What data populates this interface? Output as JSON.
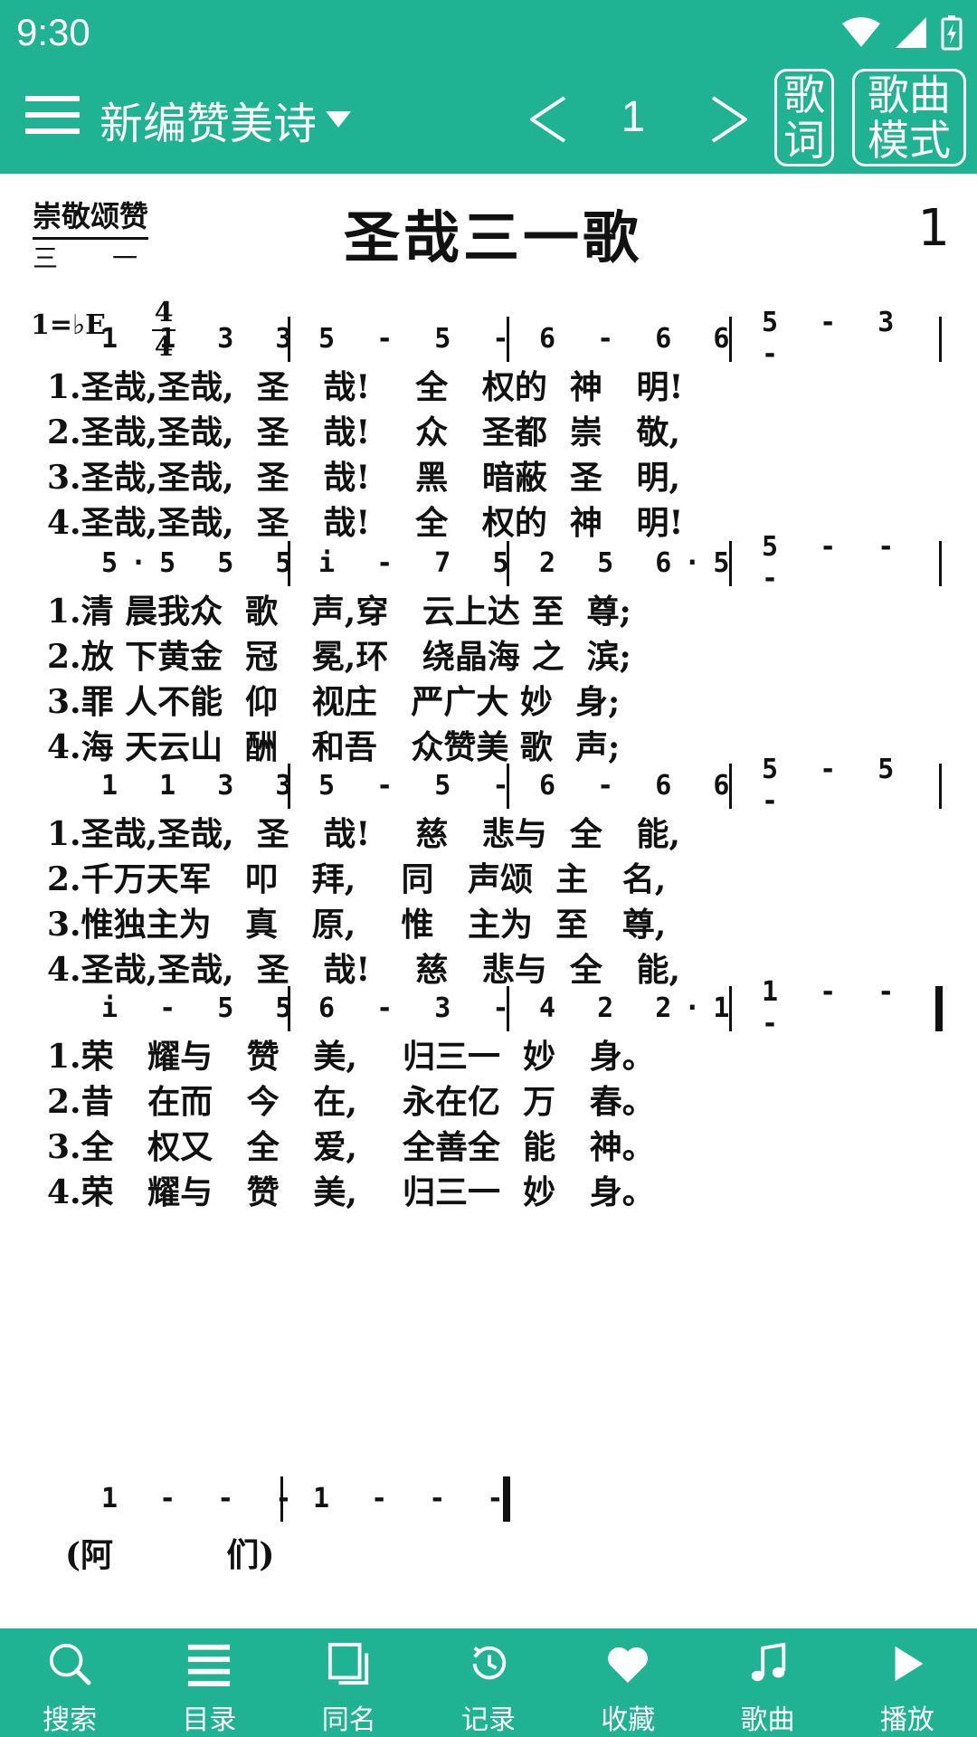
{
  "status": {
    "time": "9:30",
    "icons": [
      "wifi-icon",
      "signal-icon",
      "battery-charging-icon"
    ]
  },
  "appbar": {
    "book_title": "新编赞美诗",
    "page_number": "1",
    "lyrics_button": "歌词",
    "song_mode_button": "歌曲模式"
  },
  "score": {
    "category": "崇敬颂赞",
    "category_sub": "三一",
    "title": "圣哉三一歌",
    "number": "1",
    "key": "1=♭E",
    "time_top": "4",
    "time_bottom": "4",
    "systems": [
      {
        "measures": [
          "1 1 3 3",
          "5 - 5 -",
          "6 - 6 6",
          "5 - 3 -"
        ],
        "lyrics": [
          "1.圣哉,圣哉,  圣   哉!    全   权的  神   明!",
          "2.圣哉,圣哉,  圣   哉!    众   圣都  崇   敬,",
          "3.圣哉,圣哉,  圣   哉!    黑   暗蔽  圣   明,",
          "4.圣哉,圣哉,  圣   哉!    全   权的  神   明!"
        ]
      },
      {
        "measures": [
          "5·5 5 5",
          "i - 7 5",
          "2 5 6·5",
          "5 - - -"
        ],
        "lyrics": [
          "1.清 晨我众  歌   声,穿   云上达 至  尊;",
          "2.放 下黄金  冠   冕,环   绕晶海 之  滨;",
          "3.罪 人不能  仰   视庄   严广大 妙  身;",
          "4.海 天云山  酬   和吾   众赞美 歌  声;"
        ]
      },
      {
        "measures": [
          "1 1 3 3",
          "5 - 5 -",
          "6 - 6 6",
          "5 - 5 -"
        ],
        "lyrics": [
          "1.圣哉,圣哉,  圣   哉!    慈   悲与  全   能,",
          "2.千万天军   叩   拜,    同   声颂  主   名,",
          "3.惟独主为   真   原,    惟   主为  至   尊,",
          "4.圣哉,圣哉,  圣   哉!    慈   悲与  全   能,"
        ]
      },
      {
        "measures": [
          "i - 5 5",
          "6 - 3 -",
          "4 2 2·1",
          "1 - - -"
        ],
        "lyrics": [
          "1.荣   耀与   赞   美,    归三一  妙   身。",
          "2.昔   在而   今   在,    永在亿  万   春。",
          "3.全   权又   全   爱,    全善全  能   神。",
          "4.荣   耀与   赞   美,    归三一  妙   身。"
        ]
      },
      {
        "measures": [
          "1 - - -",
          "1 - - -"
        ],
        "lyrics": []
      }
    ],
    "amen": "(阿          们)"
  },
  "bottom_nav": [
    {
      "label": "搜索",
      "icon": "search-icon"
    },
    {
      "label": "目录",
      "icon": "list-icon"
    },
    {
      "label": "同名",
      "icon": "copy-icon"
    },
    {
      "label": "记录",
      "icon": "history-icon"
    },
    {
      "label": "收藏",
      "icon": "heart-icon"
    },
    {
      "label": "歌曲",
      "icon": "music-note-icon"
    },
    {
      "label": "播放",
      "icon": "play-icon"
    }
  ],
  "colors": {
    "accent": "#1fb393"
  }
}
